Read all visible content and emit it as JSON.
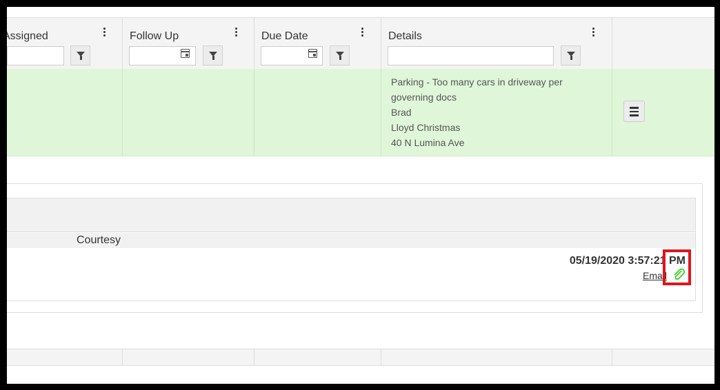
{
  "columns": {
    "assigned": {
      "title": "Assigned"
    },
    "follow_up": {
      "title": "Follow Up"
    },
    "due_date": {
      "title": "Due Date"
    },
    "details": {
      "title": "Details"
    }
  },
  "filters": {
    "assigned_value": "",
    "follow_up_value": "",
    "due_date_value": "",
    "details_value": ""
  },
  "row": {
    "details_lines": [
      "Parking - Too many cars in driveway per",
      "governing docs",
      "Brad",
      "Lloyd Christmas",
      "40 N Lumina Ave"
    ]
  },
  "panel": {
    "letter_type": "Courtesy",
    "timestamp": "05/19/2020 3:57:21 PM",
    "method_link": "Email"
  },
  "icons": {
    "kebab": "more-vert-icon",
    "filter": "funnel-icon",
    "calendar": "calendar-icon",
    "menu": "hamburger-icon",
    "attachment": "paperclip-icon"
  },
  "colors": {
    "row_highlight": "#dff6d8",
    "attachment": "#4cd137",
    "annotation": "#e0151b"
  }
}
